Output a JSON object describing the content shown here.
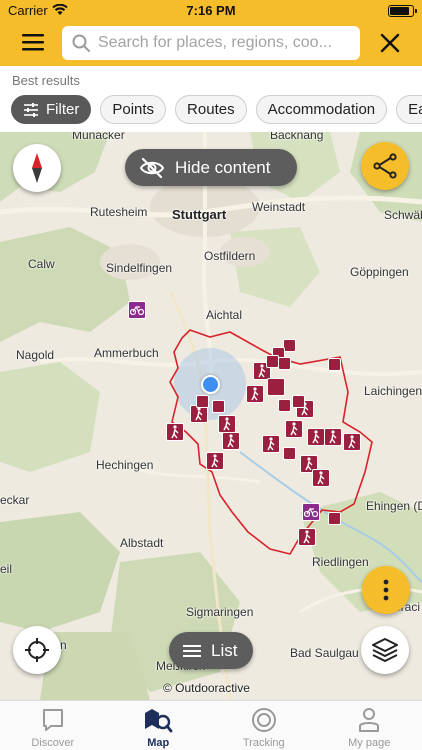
{
  "status": {
    "carrier": "Carrier",
    "time": "7:16 PM"
  },
  "header": {
    "search_placeholder": "Search for places, regions, coo...",
    "accent": "#f6bd2a"
  },
  "results": {
    "label": "Best results",
    "chips": [
      "Filter",
      "Points",
      "Routes",
      "Accommodation",
      "Eat"
    ]
  },
  "map": {
    "hide_content_label": "Hide content",
    "list_label": "List",
    "attribution": "© Outdooractive",
    "places": [
      "Munacker",
      "Backnang",
      "Rutesheim",
      "Stuttgart",
      "Weinstadt",
      "Schwäbi",
      "Calw",
      "Ostfildern",
      "Sindelfingen",
      "Göppingen",
      "Aichtal",
      "Nagold",
      "Ammerbuch",
      "Laichingen",
      "Hechingen",
      "eckar",
      "Ehingen (Do",
      "Albstadt",
      "Riedlingen",
      "eil",
      "Sigmaringen",
      "eraci",
      "Bad Saulgau",
      "ttlingen",
      "Meßkirch"
    ],
    "route_color": "#9b1f3e",
    "region_border_color": "#d8232a"
  },
  "tabs": [
    {
      "label": "Discover",
      "icon": "discover-icon"
    },
    {
      "label": "Map",
      "icon": "map-icon"
    },
    {
      "label": "Tracking",
      "icon": "tracking-icon"
    },
    {
      "label": "My page",
      "icon": "my-page-icon"
    }
  ]
}
